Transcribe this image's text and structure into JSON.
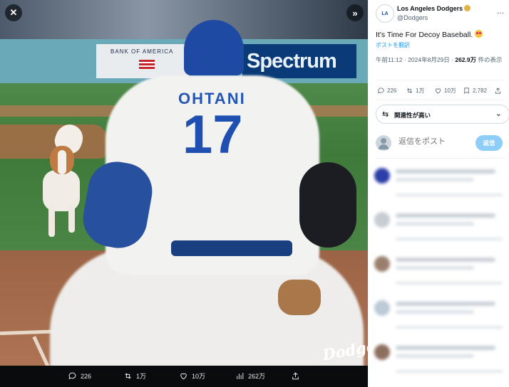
{
  "media": {
    "signs": {
      "left": "BANK OF AMERICA",
      "right": "Spectrum"
    },
    "jersey_name": "OHTANI",
    "jersey_number": "17",
    "watermark": "Dodgers",
    "close_icon": "close-icon",
    "expand_icon": "chevron-double-right-icon",
    "actions": {
      "replies": "226",
      "reposts": "1万",
      "likes": "10万",
      "views": "262万"
    }
  },
  "tweet": {
    "author_name": "Los Angeles Dodgers",
    "author_handle": "@Dodgers",
    "avatar_text": "LA",
    "more_label": "...",
    "text": "It's Time For Decoy Baseball.",
    "translate_label": "ポストを翻訳",
    "timestamp": "午前11:12 · 2024年8月29日 · ",
    "views_count": "262.9万",
    "views_suffix": " 件の表示",
    "stats": {
      "replies": "226",
      "reposts": "1万",
      "likes": "10万",
      "bookmarks": "2,782"
    },
    "sort_label": "関連性が高い",
    "reply_placeholder": "返信をポスト",
    "reply_button": "返信"
  },
  "colors": {
    "accent": "#1d9bf0",
    "reply_button": "#8ecdf8",
    "dodger_blue": "#1f4fb0"
  }
}
